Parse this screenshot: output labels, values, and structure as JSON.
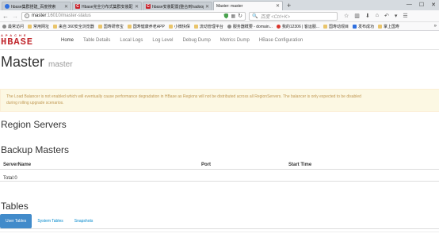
{
  "browser": {
    "tabs": [
      {
        "title": "hbase集群搭建_百度搜索",
        "favicon": "baidu",
        "active": false
      },
      {
        "title": "Hbase完全分布式集群安装配",
        "favicon": "csdn",
        "active": false
      },
      {
        "title": "hbase安装配置(整合到hadoop)",
        "favicon": "csdn",
        "active": false
      },
      {
        "title": "Master: master",
        "favicon": "hbase",
        "active": true
      }
    ],
    "close_glyph": "✕",
    "new_tab_glyph": "+",
    "window_controls": [
      "—",
      "☐",
      "✕"
    ],
    "url_host": "master",
    "url_rest": ":16010/master-status",
    "search_placeholder": "百度 <Ctrl+K>",
    "bookmarks": [
      {
        "label": "最常访问",
        "icon": "gear"
      },
      {
        "label": "常用网址",
        "icon": "folder"
      },
      {
        "label": "来自 360安全浏览器",
        "icon": "folder"
      },
      {
        "label": "国寿研修宝",
        "icon": "folder"
      },
      {
        "label": "国寿健康养老APP",
        "icon": "folder"
      },
      {
        "label": "小微快保",
        "icon": "folder"
      },
      {
        "label": "流动管理平台",
        "icon": "folder"
      },
      {
        "label": "服务器概要 - domain...",
        "icon": "gear"
      },
      {
        "label": "我的12306 | 客运服...",
        "icon": "red"
      },
      {
        "label": "国寿动观目",
        "icon": "folder"
      },
      {
        "label": "发布成功",
        "icon": "blue"
      },
      {
        "label": "掌上国寿",
        "icon": "folder"
      }
    ],
    "bookmarks_more": "»"
  },
  "site": {
    "logo_top": "APACHE",
    "logo_main": "HBASE",
    "nav": [
      "Home",
      "Table Details",
      "Local Logs",
      "Log Level",
      "Debug Dump",
      "Metrics Dump",
      "HBase Configuration"
    ]
  },
  "main": {
    "title": "Master",
    "subtitle": "master",
    "alert_line1": "The Load Balancer is not enabled which will eventually cause performance degradation in HBase as Regions will not be distributed across all RegionServers. The balancer is only expected to be disabled",
    "alert_line2": "during rolling upgrade scenarios.",
    "region_servers_heading": "Region Servers",
    "backup_masters_heading": "Backup Masters",
    "backup_columns": [
      "ServerName",
      "Port",
      "Start Time"
    ],
    "backup_total": "Total:0",
    "tables_heading": "Tables",
    "table_tabs": [
      {
        "label": "User Tables",
        "active": true
      },
      {
        "label": "System Tables",
        "active": false
      },
      {
        "label": "Snapshots",
        "active": false
      }
    ]
  }
}
